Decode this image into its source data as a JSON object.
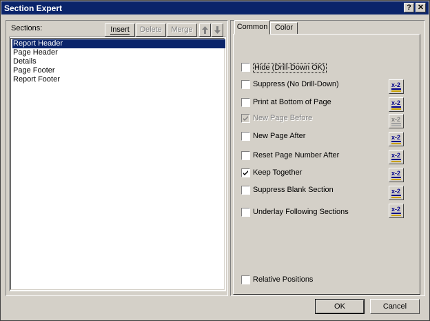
{
  "window": {
    "title": "Section Expert",
    "help_glyph": "?",
    "close_glyph": "✕"
  },
  "sections": {
    "label": "Sections:",
    "toolbar": {
      "insert": "Insert",
      "delete": "Delete",
      "merge": "Merge"
    },
    "items": [
      "Report Header",
      "Page Header",
      "Details",
      "Page Footer",
      "Report Footer"
    ],
    "selected": "Report Header"
  },
  "tabs": [
    {
      "label": "Common",
      "active": true
    },
    {
      "label": "Color",
      "active": false
    }
  ],
  "options": [
    {
      "label": "Hide (Drill-Down OK)",
      "checked": false,
      "enabled": true,
      "has_formula": false
    },
    {
      "label": "Suppress (No Drill-Down)",
      "checked": false,
      "enabled": true,
      "has_formula": true
    },
    {
      "label": "Print at Bottom of Page",
      "checked": false,
      "enabled": true,
      "has_formula": true
    },
    {
      "label": "New Page Before",
      "checked": true,
      "enabled": false,
      "has_formula": true
    },
    {
      "label": "New Page After",
      "checked": false,
      "enabled": true,
      "has_formula": true
    },
    {
      "label": "Reset Page Number After",
      "checked": false,
      "enabled": true,
      "has_formula": true
    },
    {
      "label": "Keep Together",
      "checked": true,
      "enabled": true,
      "has_formula": true
    },
    {
      "label": "Suppress Blank Section",
      "checked": false,
      "enabled": true,
      "has_formula": true
    },
    {
      "label": "Underlay Following Sections",
      "checked": false,
      "enabled": true,
      "has_formula": true
    },
    {
      "label": "Relative Positions",
      "checked": false,
      "enabled": true,
      "has_formula": false
    }
  ],
  "formula_button": {
    "glyph": "x-2",
    "icon": "formula-editor-icon"
  },
  "footer": {
    "ok": "OK",
    "cancel": "Cancel"
  },
  "colors": {
    "titlebar": "#0a246a",
    "face": "#d4d0c8",
    "selection": "#0a246a"
  }
}
